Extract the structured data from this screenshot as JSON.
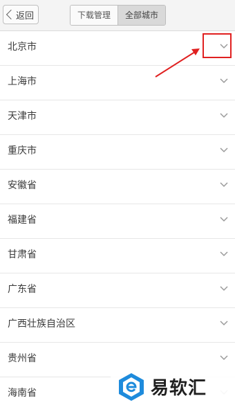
{
  "header": {
    "back_label": "返回",
    "tabs": [
      {
        "label": "下载管理",
        "active": false
      },
      {
        "label": "全部城市",
        "active": true
      }
    ]
  },
  "cities": [
    {
      "label": "北京市"
    },
    {
      "label": "上海市"
    },
    {
      "label": "天津市"
    },
    {
      "label": "重庆市"
    },
    {
      "label": "安徽省"
    },
    {
      "label": "福建省"
    },
    {
      "label": "甘肃省"
    },
    {
      "label": "广东省"
    },
    {
      "label": "广西壮族自治区"
    },
    {
      "label": "贵州省"
    },
    {
      "label": "海南省"
    }
  ],
  "annotation": {
    "color": "#e02020"
  },
  "watermark": {
    "text": "易软汇",
    "logo_color": "#1e8bdc"
  },
  "colors": {
    "chevron": "#9a9a9a",
    "separator": "#e6e6e6"
  }
}
